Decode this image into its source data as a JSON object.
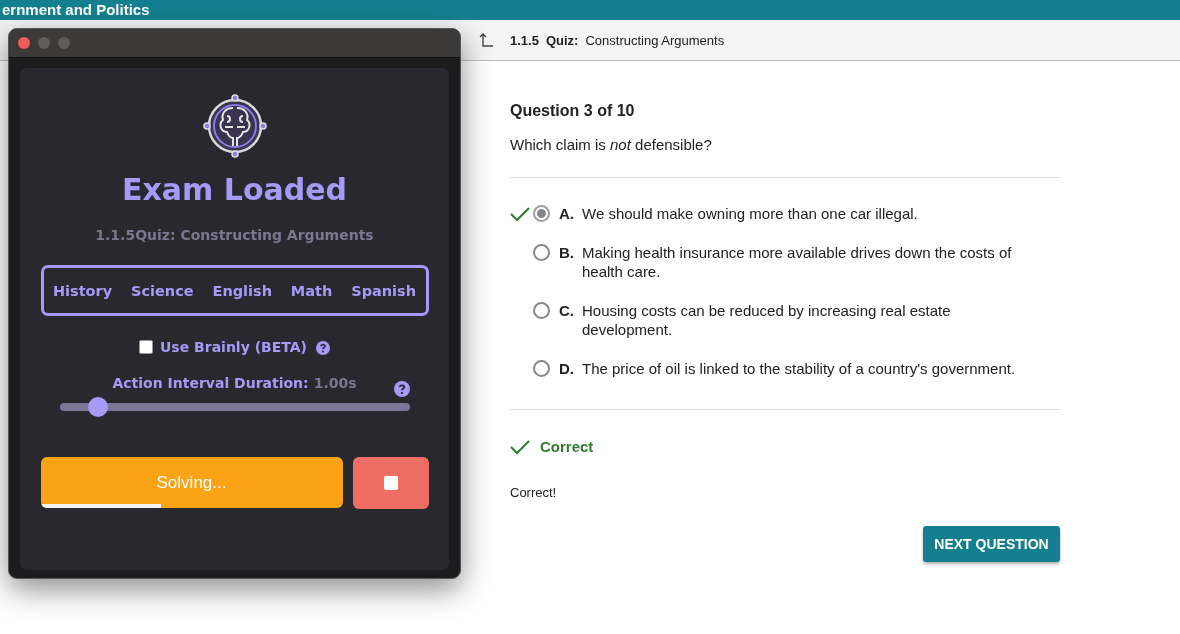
{
  "page": {
    "course_title": "ernment and Politics",
    "breadcrumb": {
      "number": "1.1.5",
      "type": "Quiz:",
      "title": "Constructing Arguments"
    },
    "question": {
      "counter": "Question 3 of 10",
      "prompt": "Which claim is *not* defensible?",
      "options": [
        {
          "letter": "A.",
          "text": "We should make owning more than one car illegal.",
          "selected": true,
          "correct": true
        },
        {
          "letter": "B.",
          "text": "Making health insurance more available drives down the costs of health care.",
          "selected": false,
          "correct": false
        },
        {
          "letter": "C.",
          "text": "Housing costs can be reduced by increasing real estate development.",
          "selected": false,
          "correct": false
        },
        {
          "letter": "D.",
          "text": "The price of oil is linked to the stability of a country's government.",
          "selected": false,
          "correct": false
        }
      ]
    },
    "feedback": {
      "status": "Correct",
      "message": "Correct!"
    },
    "next_button": "NEXT QUESTION"
  },
  "helper_window": {
    "status_title": "Exam Loaded",
    "quiz_name": "1.1.5Quiz: Constructing Arguments",
    "subjects": [
      "History",
      "Science",
      "English",
      "Math",
      "Spanish"
    ],
    "brainly": {
      "label": "Use Brainly (BETA)",
      "checked": false
    },
    "interval": {
      "label": "Action Interval Duration:",
      "value": "1.00s",
      "level": 0.11
    },
    "solve_button": {
      "label": "Solving...",
      "level": 0.4
    }
  }
}
